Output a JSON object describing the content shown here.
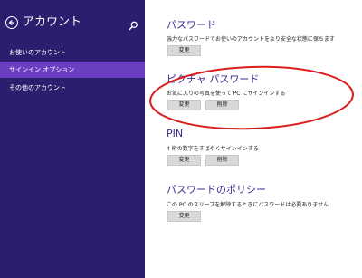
{
  "sidebar": {
    "title": "アカウント",
    "items": [
      {
        "label": "お使いのアカウント"
      },
      {
        "label": "サインイン オプション"
      },
      {
        "label": "その他のアカウント"
      }
    ]
  },
  "sections": {
    "password": {
      "title": "パスワード",
      "description": "強力なパスワードでお使いのアカウントをより安全な状態に保ちます",
      "change_label": "変更"
    },
    "picture_password": {
      "title": "ピクチャ パスワード",
      "description": "お気に入りの写真を使って PC にサインインする",
      "change_label": "変更",
      "remove_label": "削除"
    },
    "pin": {
      "title": "PIN",
      "description": "4 桁の数字をすばやくサインインする",
      "change_label": "変更",
      "remove_label": "削除"
    },
    "password_policy": {
      "title": "パスワードのポリシー",
      "description": "この PC のスリープを解除するときにパスワードは必要ありません",
      "change_label": "変更"
    }
  },
  "colors": {
    "sidebar_bg": "#2b1e6e",
    "sidebar_active": "#6b3fc2",
    "section_title": "#3f2a93",
    "annotation_red": "#d8201e"
  },
  "icons": {
    "back": "back-arrow-icon",
    "search": "search-icon"
  }
}
